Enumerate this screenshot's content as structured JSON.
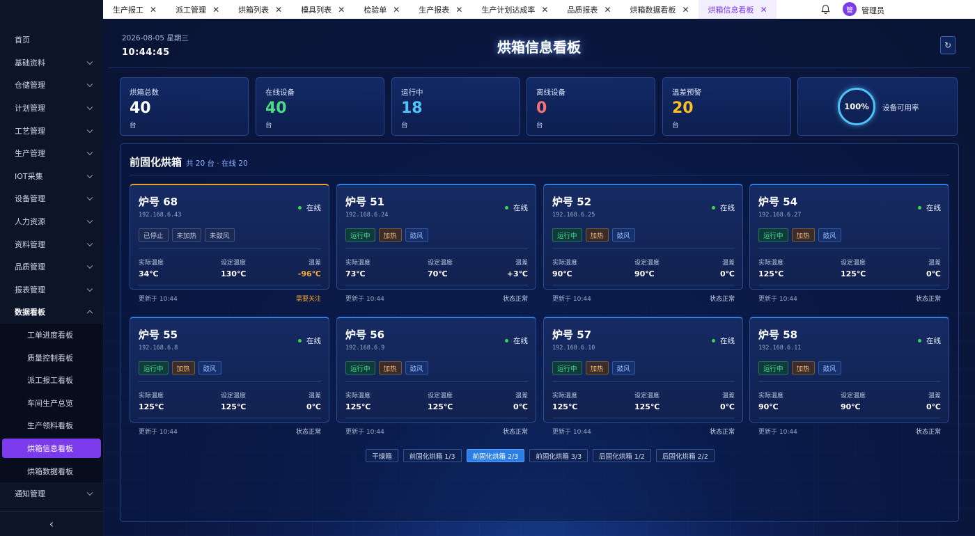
{
  "sidebar": {
    "items": [
      {
        "label": "首页"
      },
      {
        "label": "基础资料"
      },
      {
        "label": "仓储管理"
      },
      {
        "label": "计划管理"
      },
      {
        "label": "工艺管理"
      },
      {
        "label": "生产管理"
      },
      {
        "label": "IOT采集"
      },
      {
        "label": "设备管理"
      },
      {
        "label": "人力资源"
      },
      {
        "label": "资料管理"
      },
      {
        "label": "品质管理"
      },
      {
        "label": "报表管理"
      },
      {
        "label": "数据看板"
      }
    ],
    "subitems": [
      {
        "label": "工单进度看板"
      },
      {
        "label": "质量控制看板"
      },
      {
        "label": "派工报工看板"
      },
      {
        "label": "车间生产总览"
      },
      {
        "label": "生产领料看板"
      },
      {
        "label": "烘箱信息看板"
      },
      {
        "label": "烘箱数据看板"
      }
    ],
    "last_item": "通知管理",
    "collapse_icon": "‹"
  },
  "tabs": [
    {
      "label": "生产报工"
    },
    {
      "label": "派工管理"
    },
    {
      "label": "烘箱列表"
    },
    {
      "label": "模具列表"
    },
    {
      "label": "检验单"
    },
    {
      "label": "生产报表"
    },
    {
      "label": "生产计划达成率"
    },
    {
      "label": "品质报表"
    },
    {
      "label": "烘箱数据看板"
    },
    {
      "label": "烘箱信息看板"
    }
  ],
  "tab_close_icon": "✕",
  "user": {
    "avatar": "管",
    "name": "管理员"
  },
  "header": {
    "date": "2026-08-05 星期三",
    "time": "10:44:45",
    "title": "烘箱信息看板",
    "refresh_icon": "↻"
  },
  "stats": [
    {
      "label": "烘箱总数",
      "value": "40",
      "unit": "台",
      "color": "#ffffff"
    },
    {
      "label": "在线设备",
      "value": "40",
      "unit": "台",
      "color": "#4ade80"
    },
    {
      "label": "运行中",
      "value": "18",
      "unit": "台",
      "color": "#4fc3f7"
    },
    {
      "label": "离线设备",
      "value": "0",
      "unit": "台",
      "color": "#f87171"
    },
    {
      "label": "温差预警",
      "value": "20",
      "unit": "台",
      "color": "#fbbf24"
    }
  ],
  "availability": {
    "value": "100%",
    "label": "设备可用率"
  },
  "panel": {
    "title": "前固化烘箱",
    "summary": "共 20 台 · 在线 20",
    "th_actual": "实际温度",
    "th_set": "设定温度",
    "th_diff": "温差"
  },
  "cards": [
    {
      "name": "炉号 68",
      "ip": "192.168.6.43",
      "status": "在线",
      "tags": [
        "已停止",
        "未加热",
        "未鼓风"
      ],
      "actual": "34℃",
      "set": "130℃",
      "diff": "-96℃",
      "updated": "更新于 10:44",
      "state": "需要关注",
      "warn": true
    },
    {
      "name": "炉号 51",
      "ip": "192.168.6.24",
      "status": "在线",
      "tags": [
        "运行中",
        "加热",
        "鼓风"
      ],
      "actual": "73℃",
      "set": "70℃",
      "diff": "+3℃",
      "updated": "更新于 10:44",
      "state": "状态正常",
      "warn": false
    },
    {
      "name": "炉号 52",
      "ip": "192.168.6.25",
      "status": "在线",
      "tags": [
        "运行中",
        "加热",
        "鼓风"
      ],
      "actual": "90℃",
      "set": "90℃",
      "diff": "0℃",
      "updated": "更新于 10:44",
      "state": "状态正常",
      "warn": false
    },
    {
      "name": "炉号 54",
      "ip": "192.168.6.27",
      "status": "在线",
      "tags": [
        "运行中",
        "加热",
        "鼓风"
      ],
      "actual": "125℃",
      "set": "125℃",
      "diff": "0℃",
      "updated": "更新于 10:44",
      "state": "状态正常",
      "warn": false
    },
    {
      "name": "炉号 55",
      "ip": "192.168.6.8",
      "status": "在线",
      "tags": [
        "运行中",
        "加热",
        "鼓风"
      ],
      "actual": "125℃",
      "set": "125℃",
      "diff": "0℃",
      "updated": "更新于 10:44",
      "state": "状态正常",
      "warn": false
    },
    {
      "name": "炉号 56",
      "ip": "192.168.6.9",
      "status": "在线",
      "tags": [
        "运行中",
        "加热",
        "鼓风"
      ],
      "actual": "125℃",
      "set": "125℃",
      "diff": "0℃",
      "updated": "更新于 10:44",
      "state": "状态正常",
      "warn": false
    },
    {
      "name": "炉号 57",
      "ip": "192.168.6.10",
      "status": "在线",
      "tags": [
        "运行中",
        "加热",
        "鼓风"
      ],
      "actual": "125℃",
      "set": "125℃",
      "diff": "0℃",
      "updated": "更新于 10:44",
      "state": "状态正常",
      "warn": false
    },
    {
      "name": "炉号 58",
      "ip": "192.168.6.11",
      "status": "在线",
      "tags": [
        "运行中",
        "加热",
        "鼓风"
      ],
      "actual": "90℃",
      "set": "90℃",
      "diff": "0℃",
      "updated": "更新于 10:44",
      "state": "状态正常",
      "warn": false
    }
  ],
  "pager": [
    {
      "label": "干燥箱",
      "active": false
    },
    {
      "label": "前固化烘箱 1/3",
      "active": false
    },
    {
      "label": "前固化烘箱 2/3",
      "active": true
    },
    {
      "label": "前固化烘箱 3/3",
      "active": false
    },
    {
      "label": "后固化烘箱 1/2",
      "active": false
    },
    {
      "label": "后固化烘箱 2/2",
      "active": false
    }
  ]
}
